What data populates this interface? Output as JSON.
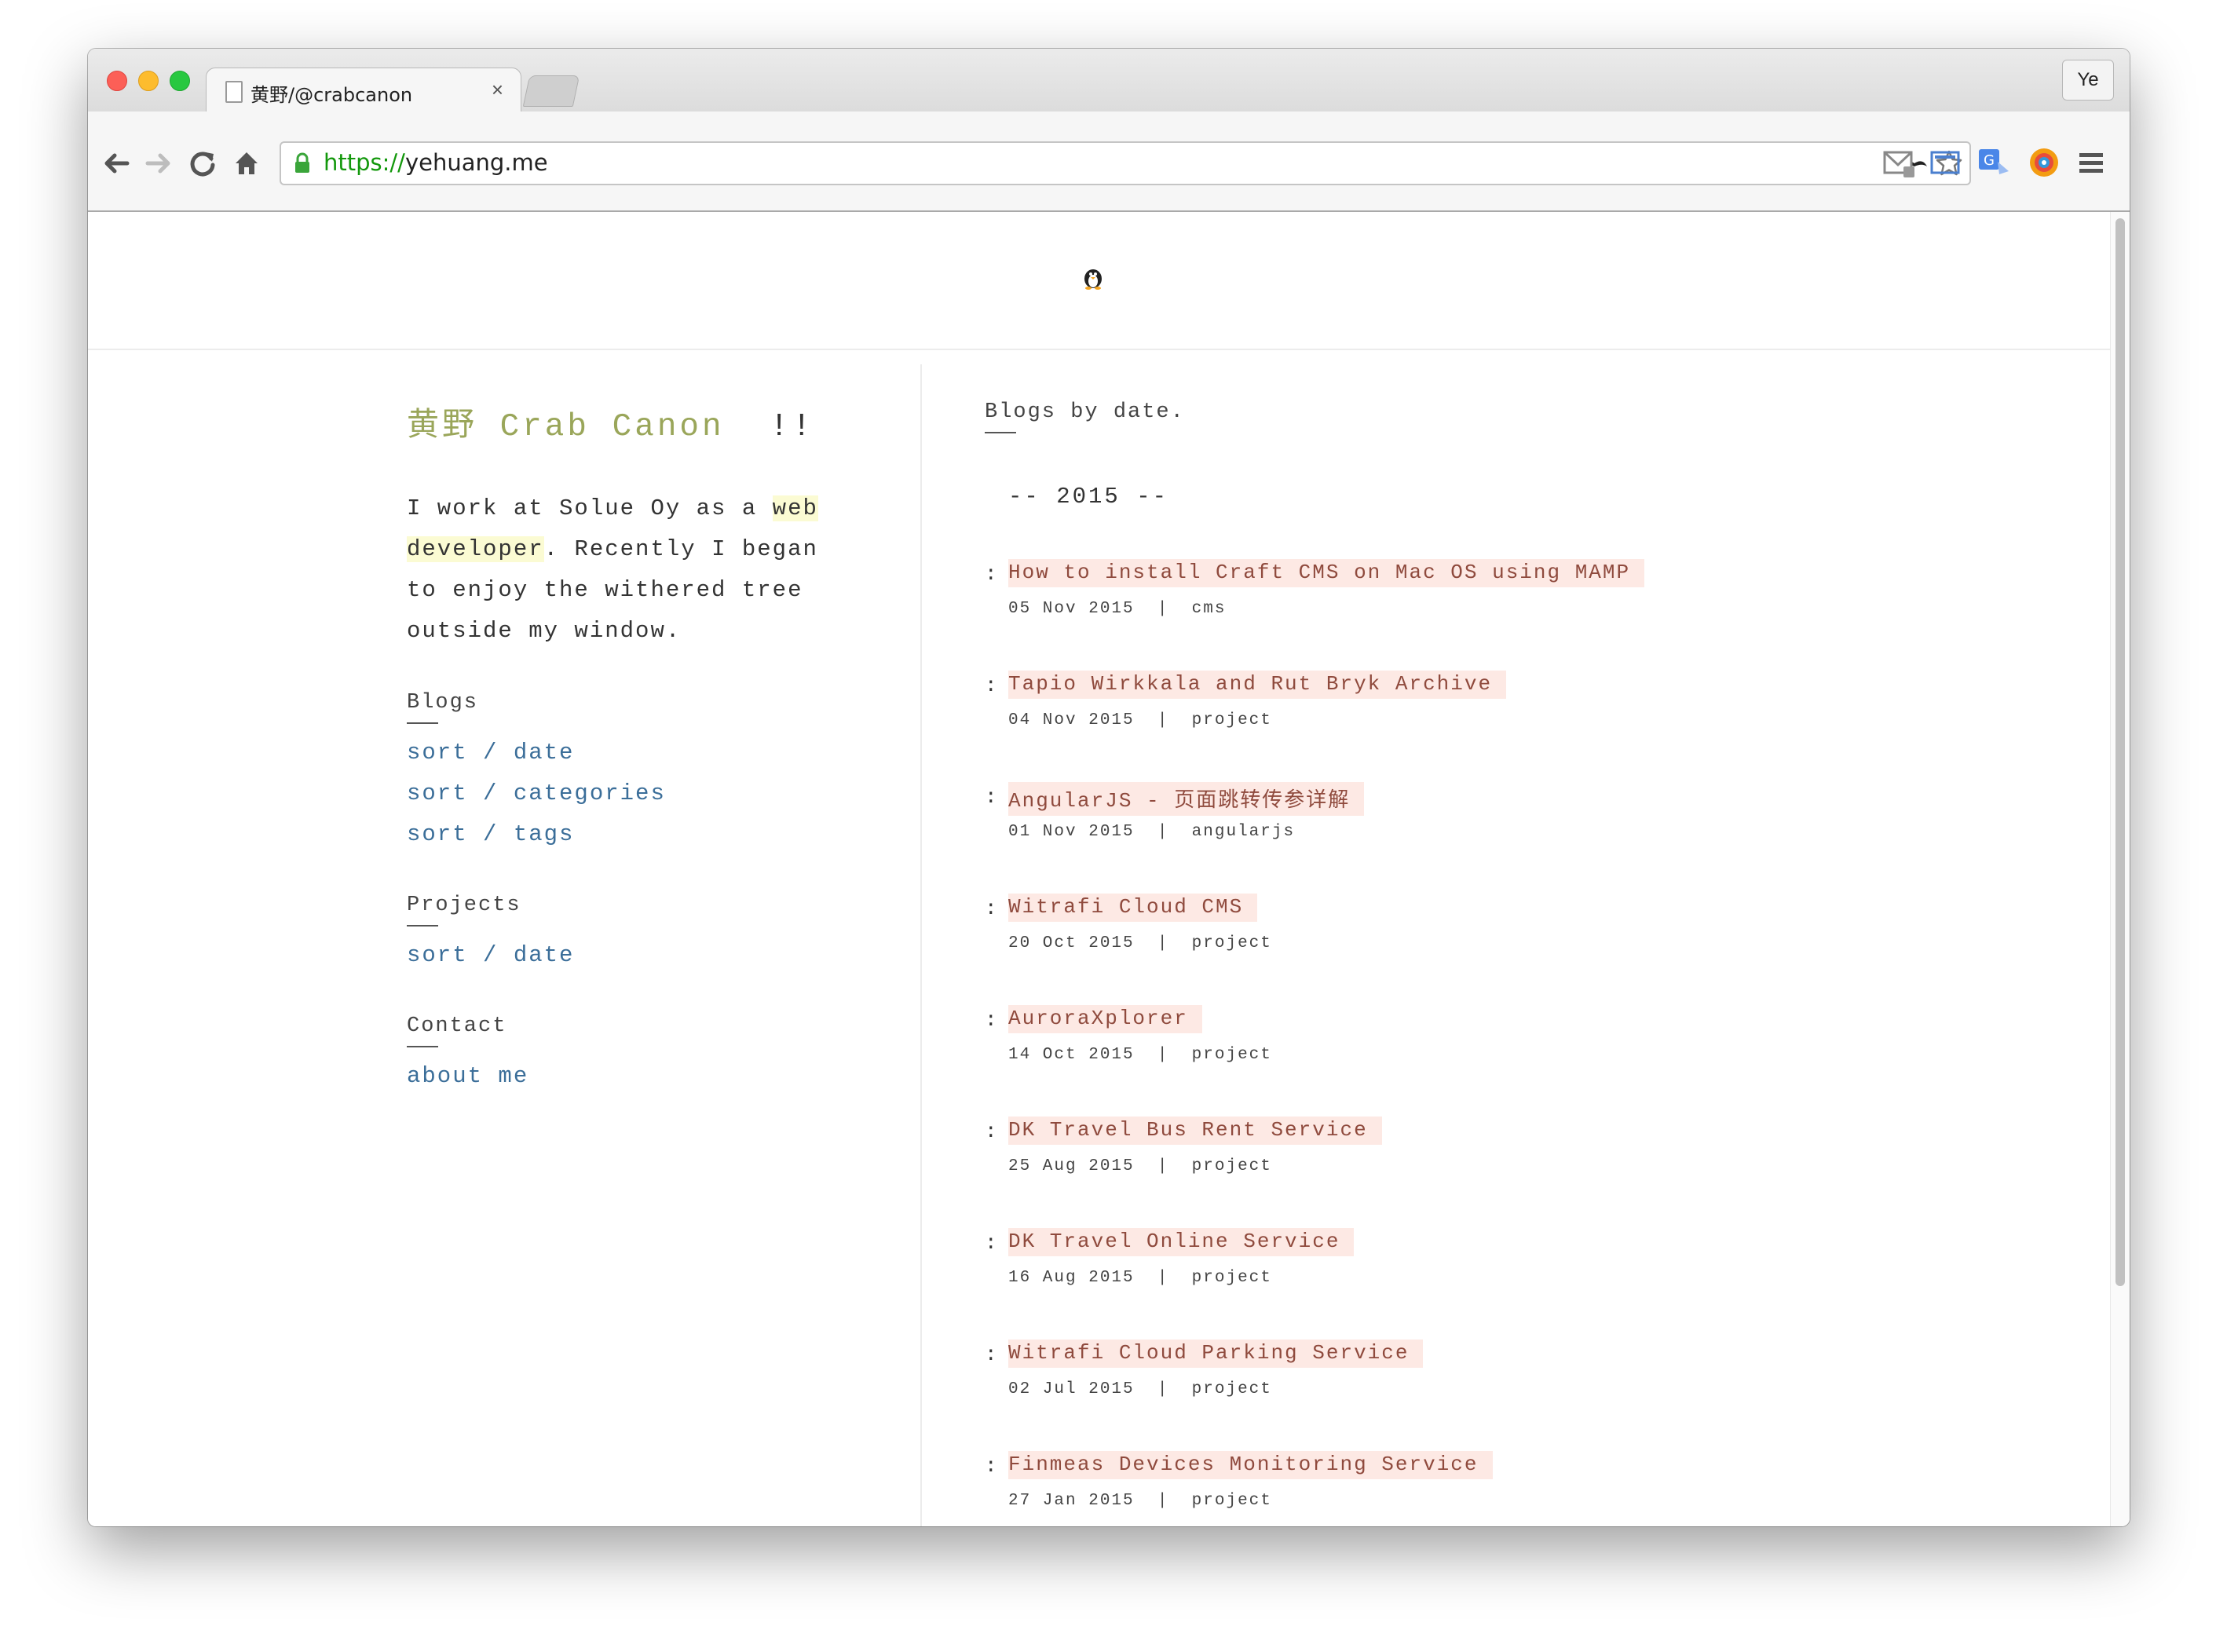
{
  "browser": {
    "tab_title": "黄野/@crabcanon",
    "tab_close": "×",
    "profile": "Ye",
    "url_scheme": "https://",
    "url_host": "yehuang.me"
  },
  "icons": {
    "back": "back-arrow-icon",
    "forward": "forward-arrow-icon",
    "reload": "reload-icon",
    "home": "home-icon",
    "lock": "lock-icon",
    "mustache": "mustache-extension-icon",
    "star": "bookmark-star-icon",
    "gmail": "gmail-extension-icon",
    "screen": "screen-capture-icon",
    "translate": "google-translate-icon",
    "colorpicker": "color-picker-icon",
    "menu": "menu-icon",
    "logo": "penguin-logo-icon"
  },
  "colors": {
    "title": "#9aa65a",
    "link": "#3b6e99",
    "post_title": "#8f4a3d",
    "post_highlight": "#fde9e4",
    "intro_highlight": "#fbfbd3"
  },
  "sidebar": {
    "title": "黄野 Crab Canon",
    "title_suffix": "!!",
    "intro_before": "I work at Solue Oy as a ",
    "intro_highlight_1": "web",
    "intro_highlight_2": "developer",
    "intro_after": ". Recently I began to enjoy the withered tree outside my window.",
    "blogs_heading": "Blogs",
    "blogs_links": [
      "sort / date",
      "sort / categories",
      "sort / tags"
    ],
    "projects_heading": "Projects",
    "projects_links": [
      "sort / date"
    ],
    "contact_heading": "Contact",
    "contact_links": [
      "about me"
    ]
  },
  "main": {
    "heading": "Blogs by date.",
    "year_label": "-- 2015 --",
    "posts": [
      {
        "title": "How to install Craft CMS on Mac OS using MAMP",
        "date": "05 Nov 2015",
        "tag": "cms"
      },
      {
        "title": "Tapio Wirkkala and Rut Bryk Archive",
        "date": "04 Nov 2015",
        "tag": "project"
      },
      {
        "title": "AngularJS - 页面跳转传参详解",
        "date": "01 Nov 2015",
        "tag": "angularjs"
      },
      {
        "title": "Witrafi Cloud CMS",
        "date": "20 Oct 2015",
        "tag": "project"
      },
      {
        "title": "AuroraXplorer",
        "date": "14 Oct 2015",
        "tag": "project"
      },
      {
        "title": "DK Travel Bus Rent Service",
        "date": "25 Aug 2015",
        "tag": "project"
      },
      {
        "title": "DK Travel Online Service",
        "date": "16 Aug 2015",
        "tag": "project"
      },
      {
        "title": "Witrafi Cloud Parking Service",
        "date": "02 Jul 2015",
        "tag": "project"
      },
      {
        "title": "Finmeas Devices Monitoring Service",
        "date": "27 Jan 2015",
        "tag": "project"
      }
    ],
    "meta_separator": "|",
    "colon": ":"
  }
}
